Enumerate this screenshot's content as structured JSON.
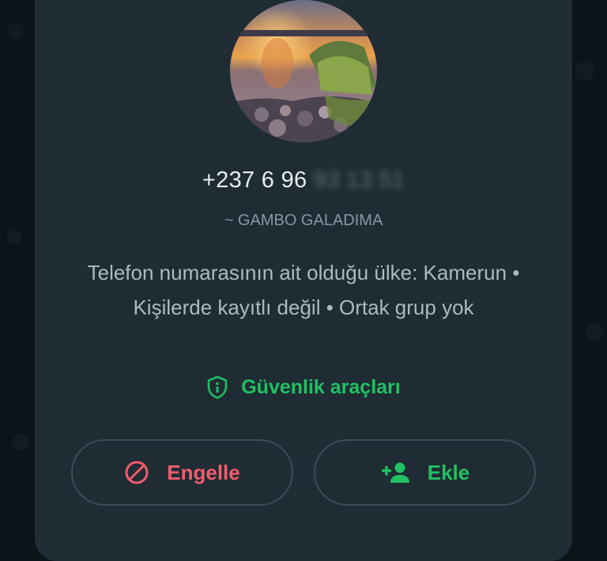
{
  "contact": {
    "phone_visible": "+237 6 96",
    "phone_blurred": "93 13 51",
    "push_name": "~ GAMBO GALADIMA"
  },
  "info": {
    "text": "Telefon numarasının ait olduğu ülke: Kamerun • Kişilerde kayıtlı değil • Ortak grup yok"
  },
  "security": {
    "label": "Güvenlik araçları",
    "icon": "shield-info-icon"
  },
  "actions": {
    "block_label": "Engelle",
    "block_icon": "block-icon",
    "add_label": "Ekle",
    "add_icon": "person-add-icon"
  },
  "colors": {
    "card_bg": "#1f2c34",
    "accent_green": "#21c063",
    "danger_red": "#f15c6d",
    "text_primary": "#e9edef",
    "text_secondary": "#8696a0"
  }
}
